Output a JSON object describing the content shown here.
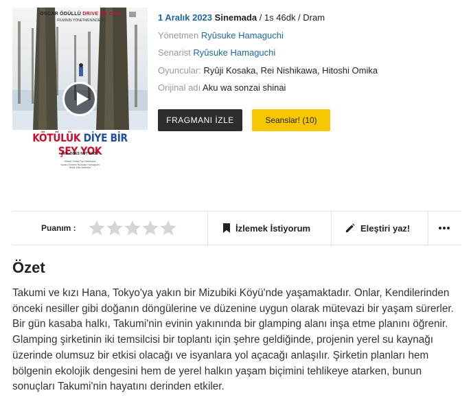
{
  "poster": {
    "oscar_text_a": "OSCAR ÖDÜLLÜ",
    "oscar_text_b": "DRIVE MY CAR",
    "subtitle": "FİLMİNİN YÖNETMENİNDEN",
    "title_a": "KÖTÜLÜK",
    "title_b": "DİYE BİR",
    "title_c": "ŞEY YOK",
    "english_title": "EVIL DOES NOT EXIST",
    "cast_line": "Hitoshi Omika   Ryo Nishikawa",
    "credits_line": "Yazan-Yöneten Ryusuke Hamaguchi",
    "music_line": "Müzik Eiko Ishibashi",
    "play_icon": "play-icon"
  },
  "info": {
    "release_date": "1 Aralık 2023",
    "release_status": "Sinemada",
    "meta": " / 1s 46dk / Dram",
    "director_label": "Yönetmen",
    "director": "Ryûsuke Hamaguchi",
    "writer_label": "Senarist",
    "writer": "Ryûsuke Hamaguchi",
    "cast_label": "Oyuncular:",
    "cast": "Ryûji Kosaka, Rei Nishikawa, Hitoshi Omika",
    "original_label": "Orijinal adı",
    "original_title": "Aku wa sonzai shinai"
  },
  "buttons": {
    "trailer": "FRAGMANI İZLE",
    "sessions": "Seanslar! (10)"
  },
  "actions": {
    "rating_label": "Puanım :",
    "star_count": 5,
    "stars_filled": 0,
    "star_icon": "star-icon",
    "watchlist_icon": "bookmark-icon",
    "watchlist": "İzlemek İstiyorum",
    "review_icon": "pencil-icon",
    "review": "Eleştiri yaz!",
    "more_icon": "more-dots-icon"
  },
  "summary": {
    "title": "Özet",
    "text": "Takumi ve kızı Hana, Tokyo'ya yakın bir Mizubiki Köyü'nde yaşamaktadır. Onlar, Kendilerinden önceki nesiller gibi doğanın döngülerine ve düzenine uygun olarak mütevazi bir yaşam sürerler. Bir gün kasaba halkı, Takumi'nin evinin yakınında bir glamping alanı inşa etme planını öğrenir. Glamping şirketinin iki temsilcisi bir toplantı için şehre geldiğinde, projenin yerel su kaynağı üzerinde olumsuz bir etkisi olacağı ve isyanlara yol açacağı anlaşılır. Şirketin planları hem bölgenin ekolojik dengesini hem de yerel halkın yaşam biçimini tehlikeye atarken, bunun sonuçları Takumi'nin hayatını derinden etkiler."
  },
  "colors": {
    "accent_blue": "#1b67a6",
    "button_dark": "#2d2d2d",
    "button_yellow": "#f7c600",
    "poster_red": "#c8102e"
  }
}
